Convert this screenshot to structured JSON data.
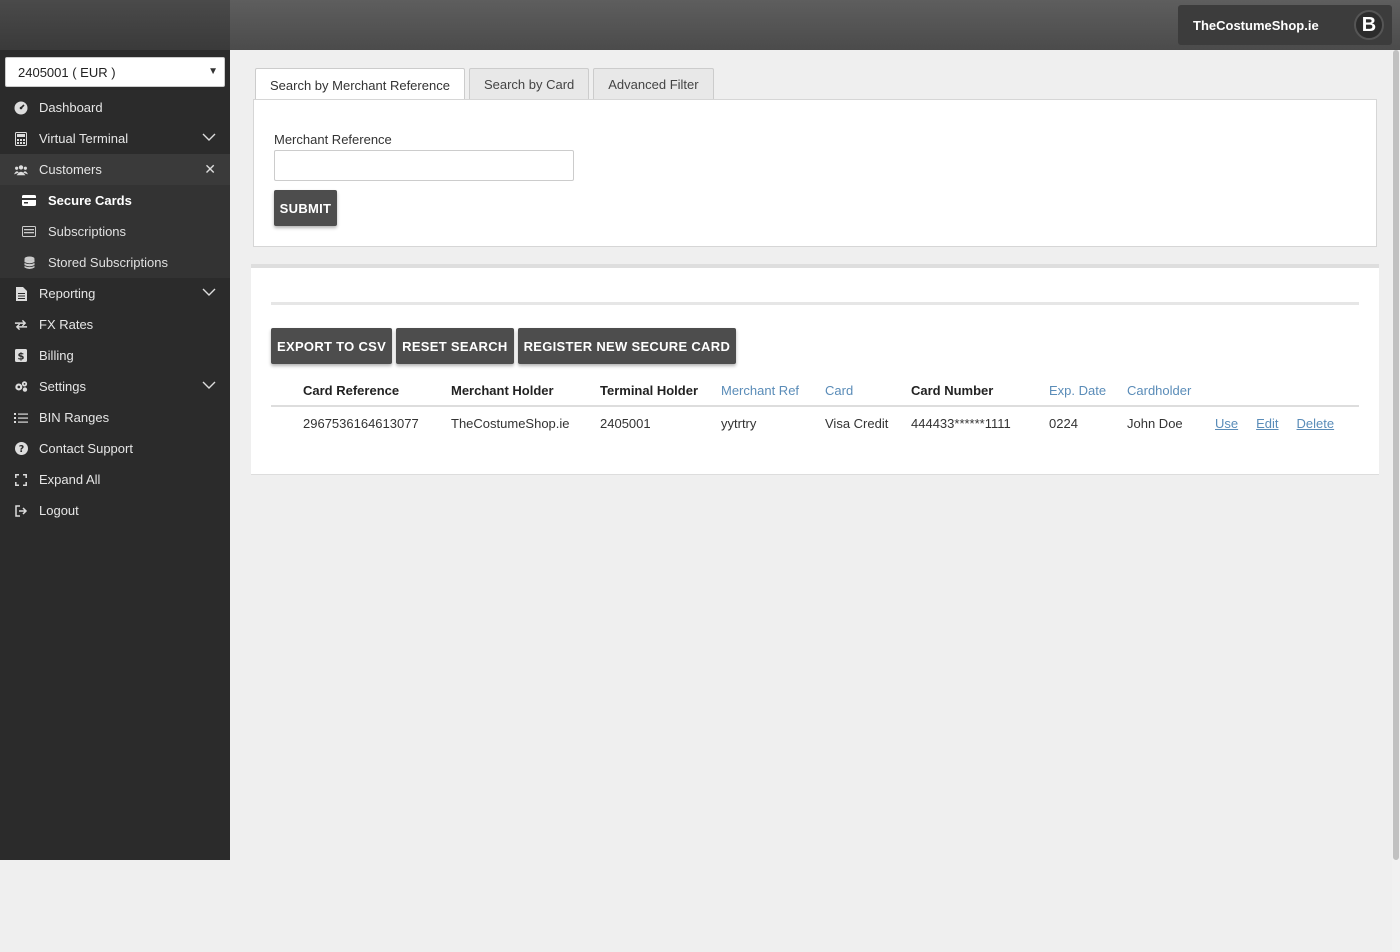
{
  "header": {
    "merchant_name": "TheCostumeShop.ie",
    "avatar_letter": "B"
  },
  "sidebar": {
    "terminal": "2405001 ( EUR )",
    "items": [
      {
        "label": "Dashboard",
        "icon": "gauge-icon"
      },
      {
        "label": "Virtual Terminal",
        "icon": "calculator-icon",
        "expandable": true
      },
      {
        "label": "Customers",
        "icon": "users-icon",
        "expanded": true
      },
      {
        "label": "Reporting",
        "icon": "file-icon",
        "expandable": true
      },
      {
        "label": "FX Rates",
        "icon": "exchange-icon"
      },
      {
        "label": "Billing",
        "icon": "dollar-icon"
      },
      {
        "label": "Settings",
        "icon": "gears-icon",
        "expandable": true
      },
      {
        "label": "BIN Ranges",
        "icon": "list-icon"
      },
      {
        "label": "Contact Support",
        "icon": "question-icon"
      },
      {
        "label": "Expand All",
        "icon": "expand-icon"
      },
      {
        "label": "Logout",
        "icon": "sign-out-icon"
      }
    ],
    "sub_items": [
      {
        "label": "Secure Cards",
        "icon": "credit-card-icon"
      },
      {
        "label": "Subscriptions",
        "icon": "card-list-icon"
      },
      {
        "label": "Stored Subscriptions",
        "icon": "database-icon"
      }
    ]
  },
  "tabs": [
    "Search by Merchant Reference",
    "Search by Card",
    "Advanced Filter"
  ],
  "search": {
    "label": "Merchant Reference",
    "value": "",
    "submit_label": "SUBMIT"
  },
  "actions": {
    "export": "EXPORT TO CSV",
    "reset": "RESET SEARCH",
    "register": "REGISTER NEW SECURE CARD"
  },
  "table": {
    "columns": [
      "Card Reference",
      "Merchant Holder",
      "Terminal Holder",
      "Merchant Ref",
      "Card",
      "Card Number",
      "Exp. Date",
      "Cardholder"
    ],
    "rows": [
      {
        "card_reference": "2967536164613077",
        "merchant_holder": "TheCostumeShop.ie",
        "terminal_holder": "2405001",
        "merchant_ref": "yytrtry",
        "card": "Visa Credit",
        "card_number": "444433******1111",
        "exp_date": "0224",
        "cardholder": "John Doe",
        "actions": [
          "Use",
          "Edit",
          "Delete"
        ]
      }
    ]
  },
  "colors": {
    "link": "#5a8cb8",
    "sidebar_bg": "#2b2b2b",
    "button_bg": "#4d4d4d"
  }
}
